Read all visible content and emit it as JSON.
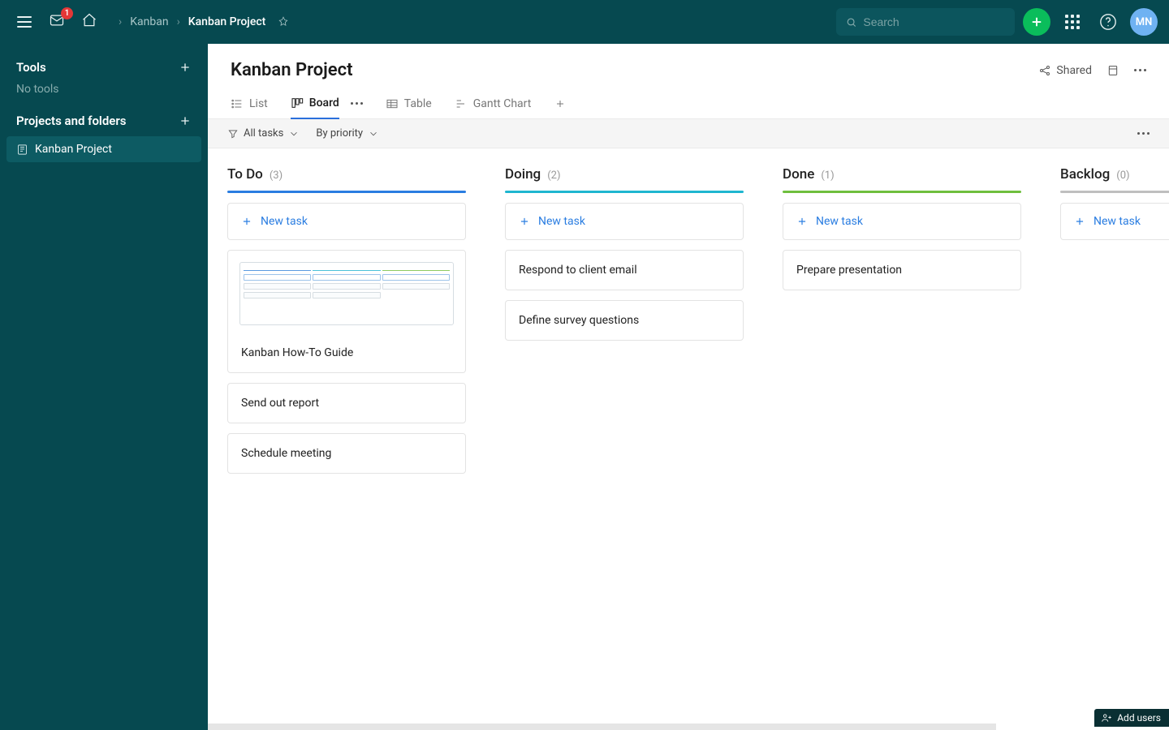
{
  "topbar": {
    "mail_badge": "1",
    "breadcrumb": {
      "parent": "Kanban",
      "current": "Kanban Project"
    },
    "search_placeholder": "Search",
    "avatar_initials": "MN"
  },
  "sidebar": {
    "tools_heading": "Tools",
    "no_tools": "No tools",
    "projects_heading": "Projects and folders",
    "project_item": "Kanban Project"
  },
  "page": {
    "title": "Kanban Project",
    "shared_label": "Shared"
  },
  "tabs": {
    "list": "List",
    "board": "Board",
    "table": "Table",
    "gantt": "Gantt Chart"
  },
  "filters": {
    "all_tasks": "All tasks",
    "by_priority": "By priority"
  },
  "columns": {
    "todo": {
      "title": "To Do",
      "count": "(3)",
      "new_label": "New task"
    },
    "doing": {
      "title": "Doing",
      "count": "(2)",
      "new_label": "New task"
    },
    "done": {
      "title": "Done",
      "count": "(1)",
      "new_label": "New task"
    },
    "backlog": {
      "title": "Backlog",
      "count": "(0)",
      "new_label": "New task"
    }
  },
  "cards": {
    "todo_1": "Kanban How-To Guide",
    "todo_2": "Send out report",
    "todo_3": "Schedule meeting",
    "doing_1": "Respond to client email",
    "doing_2": "Define survey questions",
    "done_1": "Prepare presentation"
  },
  "footer": {
    "add_users": "Add users"
  }
}
